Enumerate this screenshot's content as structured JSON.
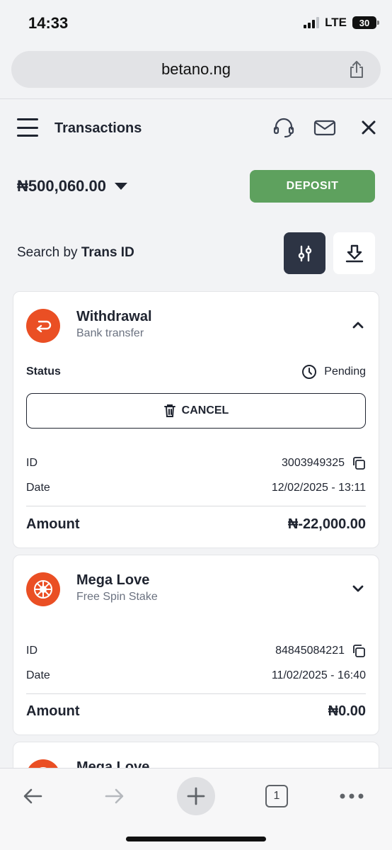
{
  "status_bar": {
    "time": "14:33",
    "network": "LTE",
    "battery": "30"
  },
  "browser": {
    "url": "betano.ng",
    "share_icon": "share-icon",
    "tab_count": "1"
  },
  "header": {
    "title": "Transactions",
    "support_icon": "headset-icon",
    "mail_icon": "mail-icon",
    "close_icon": "close-icon"
  },
  "wallet": {
    "balance": "₦500,060.00",
    "deposit_label": "DEPOSIT",
    "accent": "#5ea15e"
  },
  "search": {
    "prefix": "Search by ",
    "field": "Trans ID"
  },
  "transactions": [
    {
      "title": "Withdrawal",
      "subtitle": "Bank transfer",
      "icon": "return-arrow-icon",
      "expanded": true,
      "status_label": "Status",
      "status_value": "Pending",
      "cancel_label": "CANCEL",
      "id_label": "ID",
      "id_value": "3003949325",
      "date_label": "Date",
      "date_value": "12/02/2025 - 13:11",
      "amount_label": "Amount",
      "amount_value": "₦-22,000.00"
    },
    {
      "title": "Mega Love",
      "subtitle": "Free Spin Stake",
      "icon": "casino-wheel-icon",
      "expanded": false,
      "id_label": "ID",
      "id_value": "84845084221",
      "date_label": "Date",
      "date_value": "11/02/2025 - 16:40",
      "amount_label": "Amount",
      "amount_value": "₦0.00"
    },
    {
      "title": "Mega Love",
      "icon": "casino-wheel-icon"
    }
  ],
  "colors": {
    "brand_orange": "#ea4f24",
    "dark_button": "#2d3444"
  }
}
